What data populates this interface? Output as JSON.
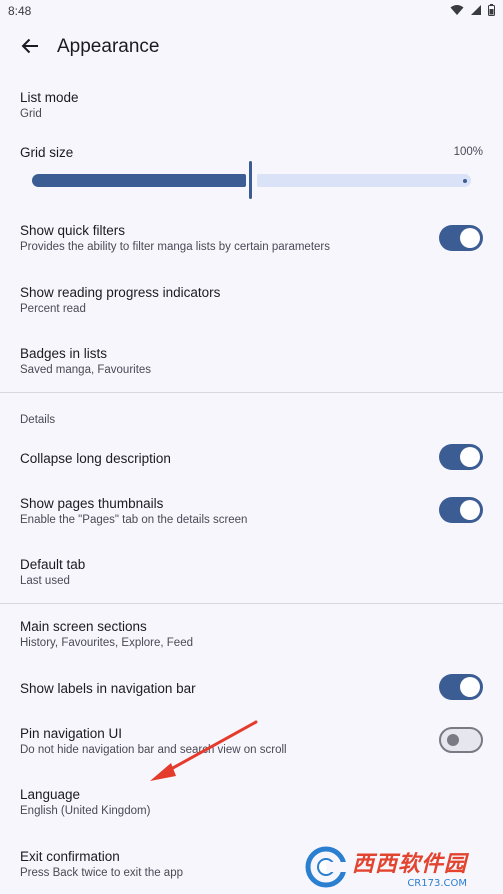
{
  "status_bar": {
    "time": "8:48"
  },
  "app_bar": {
    "title": "Appearance"
  },
  "list_mode": {
    "title": "List mode",
    "value": "Grid"
  },
  "grid_size": {
    "title": "Grid size",
    "value": "100%",
    "level": 0.5
  },
  "show_quick_filters": {
    "title": "Show quick filters",
    "summary": "Provides the ability to filter manga lists by certain parameters",
    "enabled": true
  },
  "reading_progress": {
    "title": "Show reading progress indicators",
    "value": "Percent read"
  },
  "badges": {
    "title": "Badges in lists",
    "value": "Saved manga, Favourites"
  },
  "details_section": {
    "header": "Details"
  },
  "collapse_description": {
    "title": "Collapse long description",
    "enabled": true
  },
  "pages_thumbnails": {
    "title": "Show pages thumbnails",
    "summary": "Enable the \"Pages\" tab on the details screen",
    "enabled": true
  },
  "default_tab": {
    "title": "Default tab",
    "value": "Last used"
  },
  "main_screen_sections": {
    "title": "Main screen sections",
    "value": "History, Favourites, Explore, Feed"
  },
  "nav_labels": {
    "title": "Show labels in navigation bar",
    "enabled": true
  },
  "pin_nav": {
    "title": "Pin navigation UI",
    "summary": "Do not hide navigation bar and search view on scroll",
    "enabled": false
  },
  "language": {
    "title": "Language",
    "value": "English (United Kingdom)"
  },
  "exit_confirmation": {
    "title": "Exit confirmation",
    "summary": "Press Back twice to exit the app"
  },
  "watermark": {
    "text": "西西软件园",
    "sub": "CR173.COM"
  },
  "colors": {
    "accent": "#3c5d93",
    "track_inactive": "#d9e2f6",
    "background": "#f7f6fc",
    "annotation_arrow": "#e53b2c"
  },
  "icons": {
    "back": "arrow-back-icon",
    "wifi": "wifi-icon",
    "signal": "signal-icon",
    "battery": "battery-icon"
  }
}
